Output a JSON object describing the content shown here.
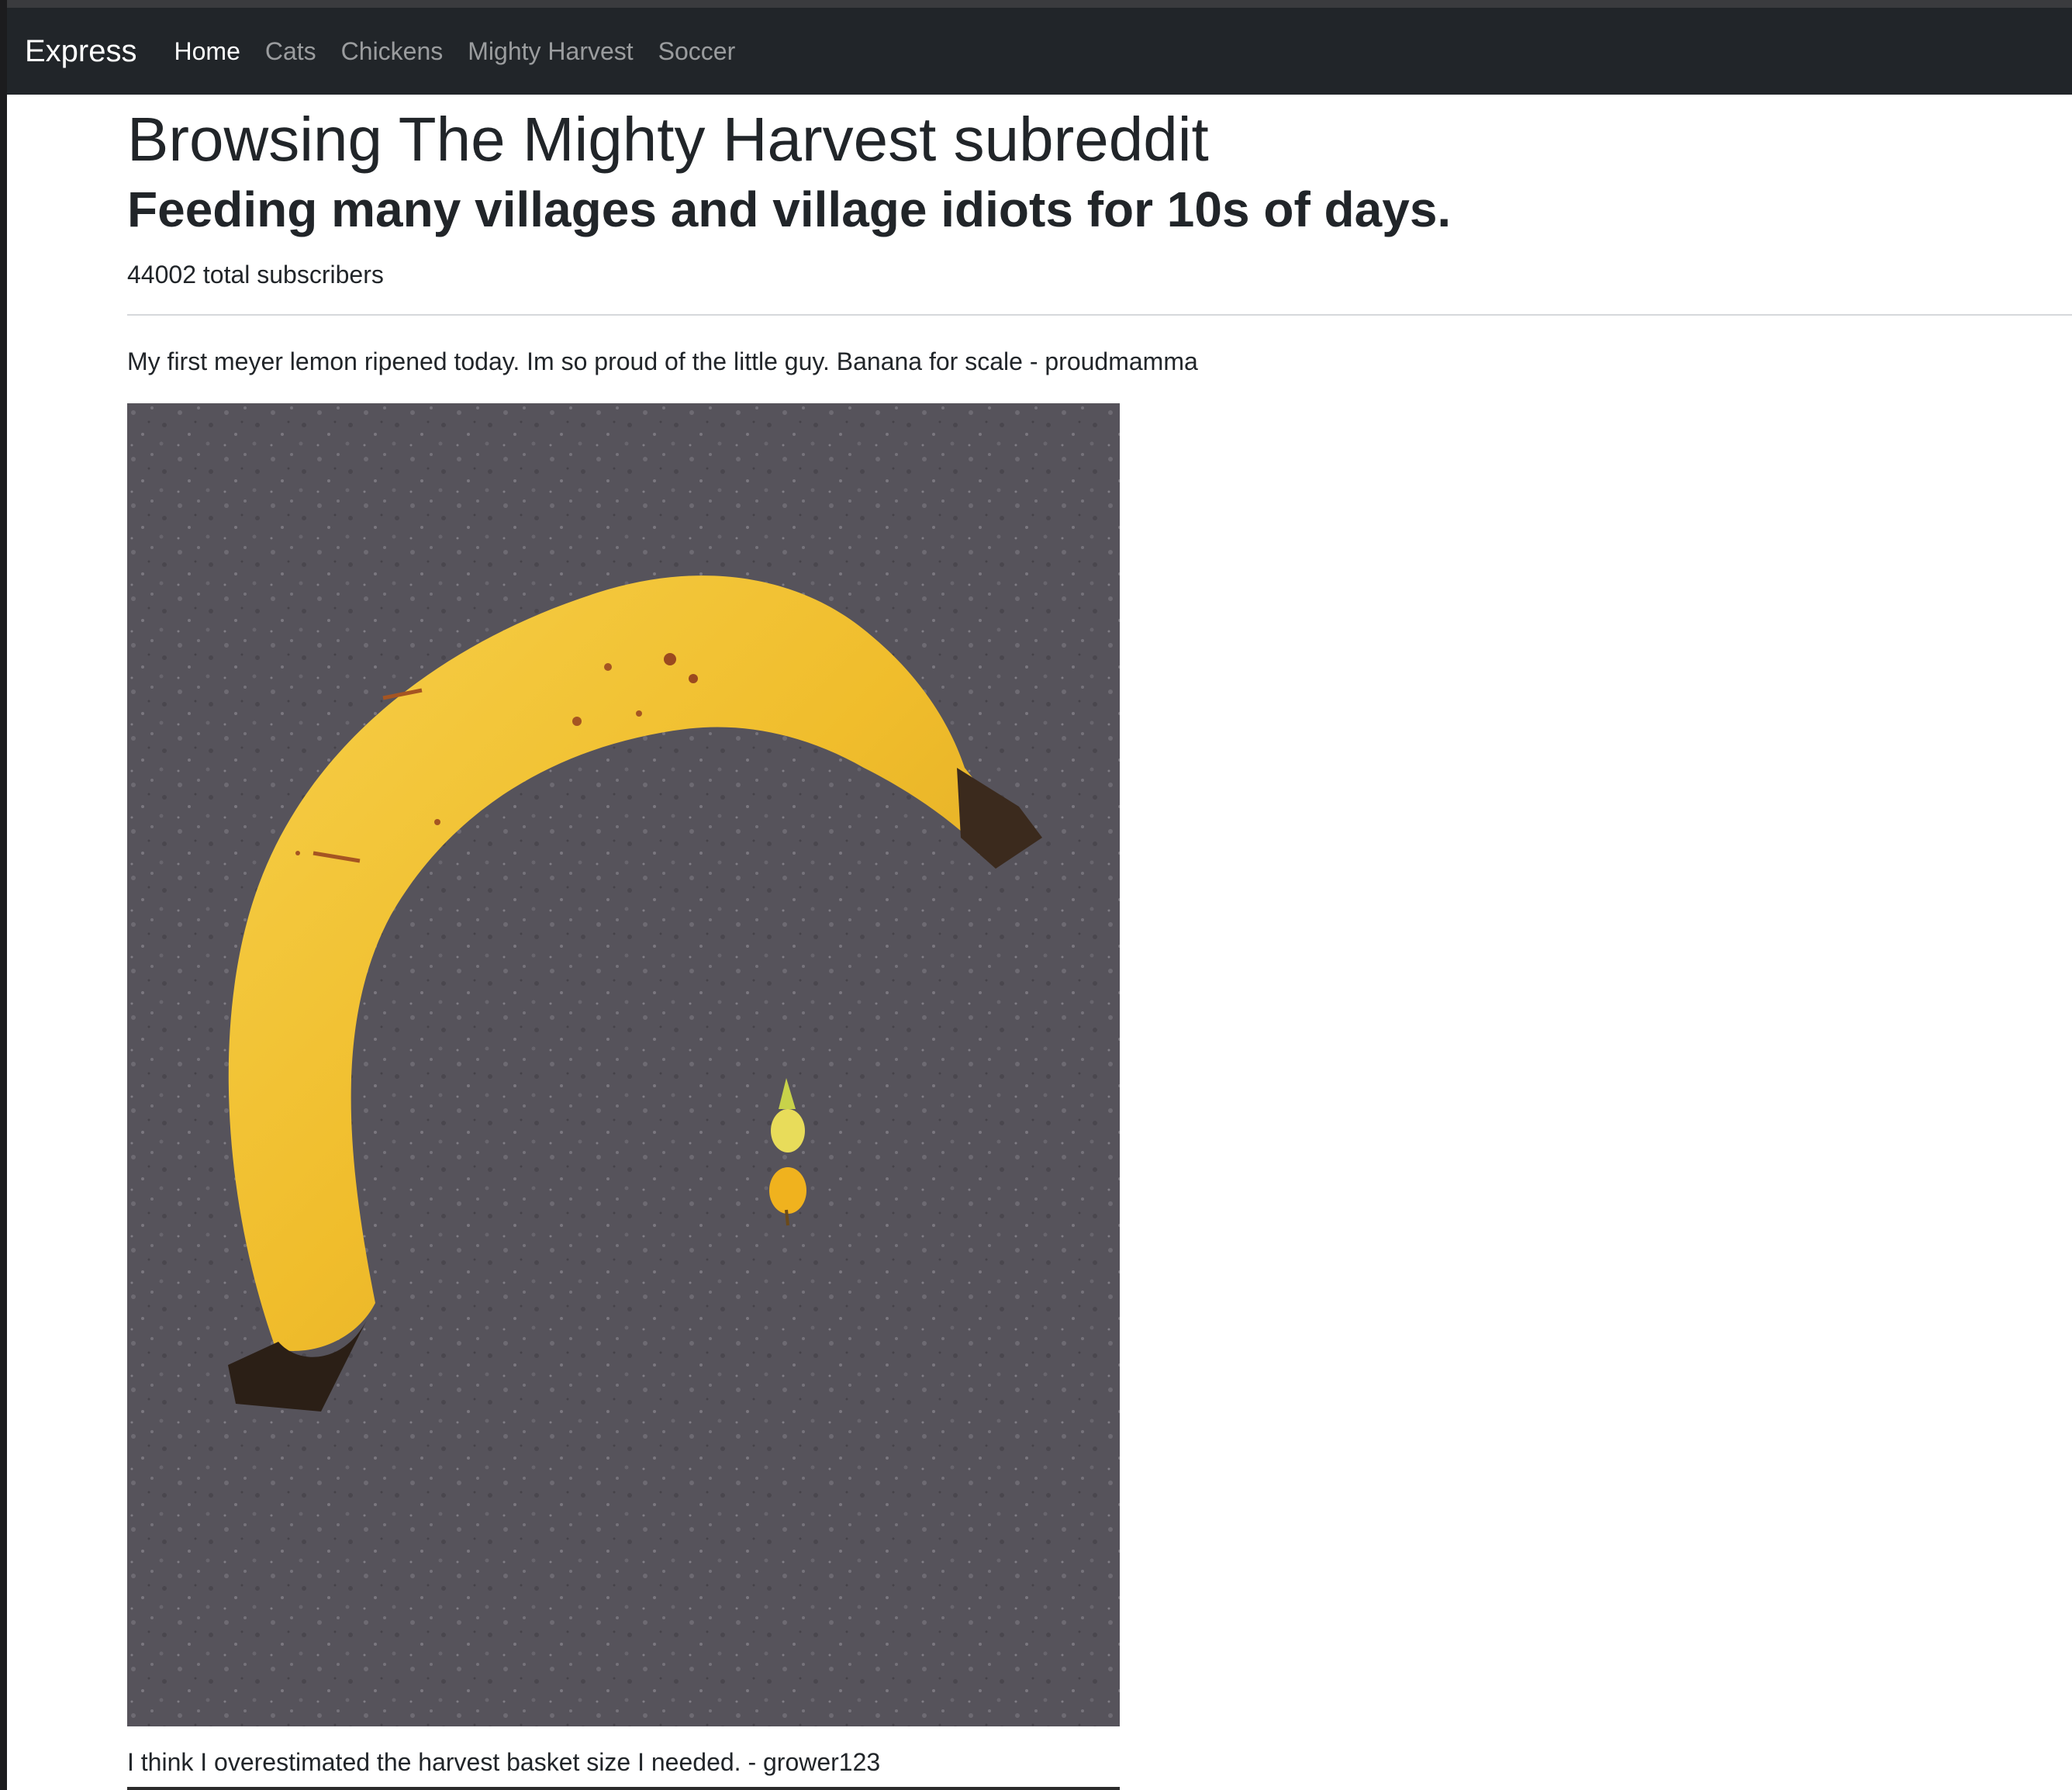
{
  "navbar": {
    "brand": "Express",
    "links": [
      {
        "label": "Home",
        "active": true
      },
      {
        "label": "Cats",
        "active": false
      },
      {
        "label": "Chickens",
        "active": false
      },
      {
        "label": "Mighty Harvest",
        "active": false
      },
      {
        "label": "Soccer",
        "active": false
      }
    ]
  },
  "main": {
    "title": "Browsing The Mighty Harvest subreddit",
    "subtitle": "Feeding many villages and village idiots for 10s of days.",
    "subscribers_text": "44002 total subscribers"
  },
  "posts": [
    {
      "caption_above": "My first meyer lemon ripened today. Im so proud of the little guy. Banana for scale - proudmamma",
      "image": "photo-banana-and-tiny-lemon",
      "caption_below": "I think I overestimated the harvest basket size I needed. - grower123"
    }
  ],
  "colors": {
    "navbar_bg": "#212529",
    "nav_active": "#ffffff",
    "nav_inactive": "rgba(255,255,255,0.55)",
    "text": "#212529",
    "countertop": "#55525a",
    "banana": "#f2c12e"
  }
}
